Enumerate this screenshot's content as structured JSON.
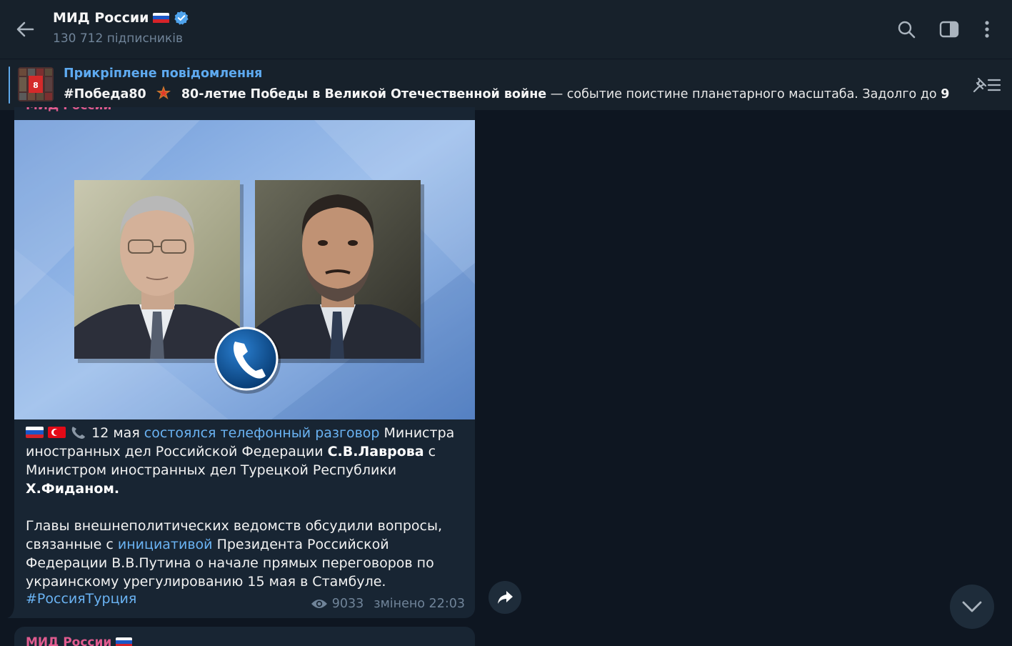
{
  "header": {
    "channel_name": "МИД России",
    "subscribers": "130 712 підписників"
  },
  "pinned": {
    "label": "Прикріплене повідомлення",
    "hashtag": "#Победа80",
    "bold_text": "80-летие Победы в Великой Отечественной войне",
    "rest_text": " — событие поистине планетарного масштаба. Задолго до ",
    "bold_tail": "9 ..."
  },
  "message": {
    "sender_cut": "МИД России",
    "p1_date": " 12 мая ",
    "p1_link": "состоялся телефонный разговор",
    "p1_a": " Министра иностранных дел Российской Федерации ",
    "p1_b1": "С.В.Лаврова",
    "p1_c": " с Министром иностранных дел Турецкой Республики ",
    "p1_b2": "Х.Фиданом.",
    "p2_a": "Главы внешнеполитических ведомств обсудили вопросы, связанные с ",
    "p2_link": "инициативой",
    "p2_b": " Президента Российской Федерации В.В.Путина о начале прямых переговоров по украинскому урегулированию 15 мая в Стамбуле.",
    "hashtag": "#РоссияТурция",
    "views": "9033",
    "edited": "змінено 22:03"
  },
  "next_message": {
    "sender": "МИД России"
  },
  "colors": {
    "bg": "#0e1621",
    "panel": "#17212b",
    "bubble": "#182533",
    "link": "#6ab3f3",
    "muted": "#708499",
    "sender": "#e05b8f"
  },
  "icons": [
    "back-arrow-icon",
    "verified-icon",
    "search-icon",
    "sidebar-toggle-icon",
    "more-vertical-icon",
    "pin-list-icon",
    "eye-icon",
    "share-icon",
    "chevron-down-icon",
    "phone-icon"
  ]
}
